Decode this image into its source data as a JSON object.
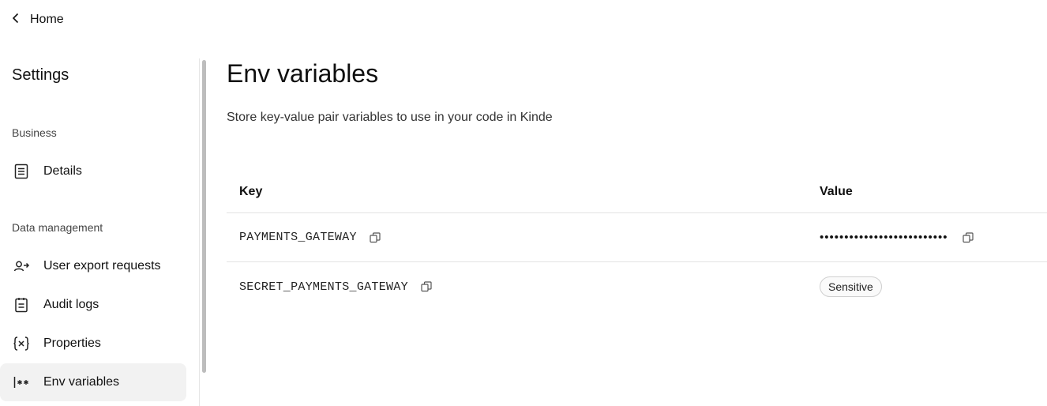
{
  "nav": {
    "home_label": "Home"
  },
  "sidebar": {
    "title": "Settings",
    "sections": [
      {
        "label": "Business",
        "items": [
          {
            "label": "Details",
            "icon": "document-icon"
          }
        ]
      },
      {
        "label": "Data management",
        "items": [
          {
            "label": "User export requests",
            "icon": "user-export-icon"
          },
          {
            "label": "Audit logs",
            "icon": "clipboard-icon"
          },
          {
            "label": "Properties",
            "icon": "variable-x-icon"
          },
          {
            "label": "Env variables",
            "icon": "env-variable-icon",
            "active": true
          }
        ]
      }
    ]
  },
  "main": {
    "title": "Env variables",
    "description": "Store key-value pair variables to use in your code in Kinde",
    "table": {
      "headers": {
        "key": "Key",
        "value": "Value"
      },
      "rows": [
        {
          "key": "PAYMENTS_GATEWAY",
          "value": "••••••••••••••••••••••••••"
        },
        {
          "key": "SECRET_PAYMENTS_GATEWAY",
          "value": "Sensitive"
        }
      ]
    }
  }
}
